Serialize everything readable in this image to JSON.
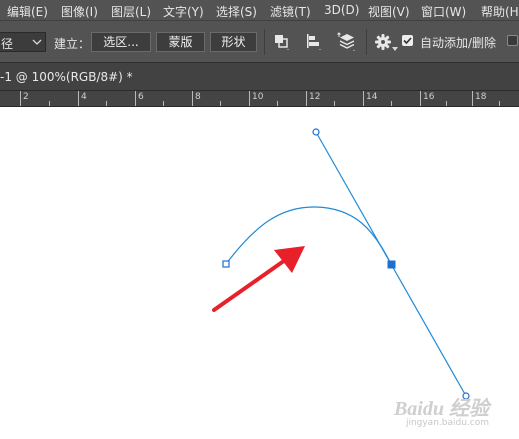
{
  "menubar": {
    "items": [
      {
        "label": "编辑(E)"
      },
      {
        "label": "图像(I)"
      },
      {
        "label": "图层(L)"
      },
      {
        "label": "文字(Y)"
      },
      {
        "label": "选择(S)"
      },
      {
        "label": "滤镜(T)"
      },
      {
        "label": "3D(D)"
      },
      {
        "label": "视图(V)"
      },
      {
        "label": "窗口(W)"
      },
      {
        "label": "帮助(H)"
      }
    ]
  },
  "options_bar": {
    "mode_value": "径",
    "make_label": "建立：",
    "selection_button": "选区...",
    "mask_button": "蒙版",
    "shape_button": "形状",
    "auto_add_delete_label": "自动添加/删除",
    "auto_add_delete_checked": true
  },
  "document_tab": {
    "title": "-1 @ 100%(RGB/8#) *"
  },
  "ruler": {
    "ticks": [
      "2",
      "4",
      "6",
      "8",
      "10",
      "12",
      "14",
      "16",
      "18"
    ]
  },
  "watermark": {
    "logo_text": "Baidu 经验",
    "url": "jingyan.baidu.com"
  },
  "colors": {
    "panel": "#535353",
    "path_stroke": "#1f8ad8",
    "anchor_fill": "#1f6fd0",
    "arrow": "#e8202a"
  }
}
